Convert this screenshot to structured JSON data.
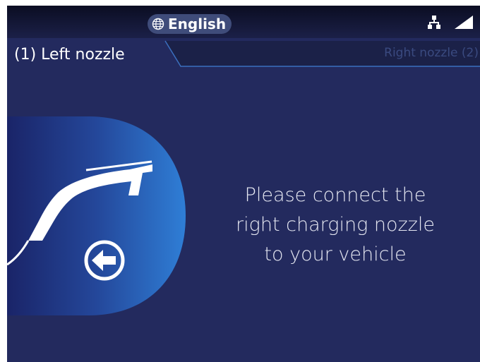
{
  "header": {
    "language_label": "English",
    "icons": [
      "globe-icon",
      "network-icon",
      "signal-icon"
    ]
  },
  "tabs": {
    "left_label": "(1) Left nozzle",
    "right_label": "Right nozzle (2)"
  },
  "main": {
    "message_lines": [
      "Please connect the",
      "right charging nozzle",
      "to your vehicle"
    ],
    "icons": [
      "charging-nozzle-icon",
      "arrow-left-circle-icon"
    ]
  },
  "colors": {
    "background": "#232a5e",
    "topbar": "#0b0d22",
    "panel_gradient_start": "#1a2468",
    "panel_gradient_end": "#2f7ed6",
    "inactive_tab_text": "#3a4a80"
  }
}
